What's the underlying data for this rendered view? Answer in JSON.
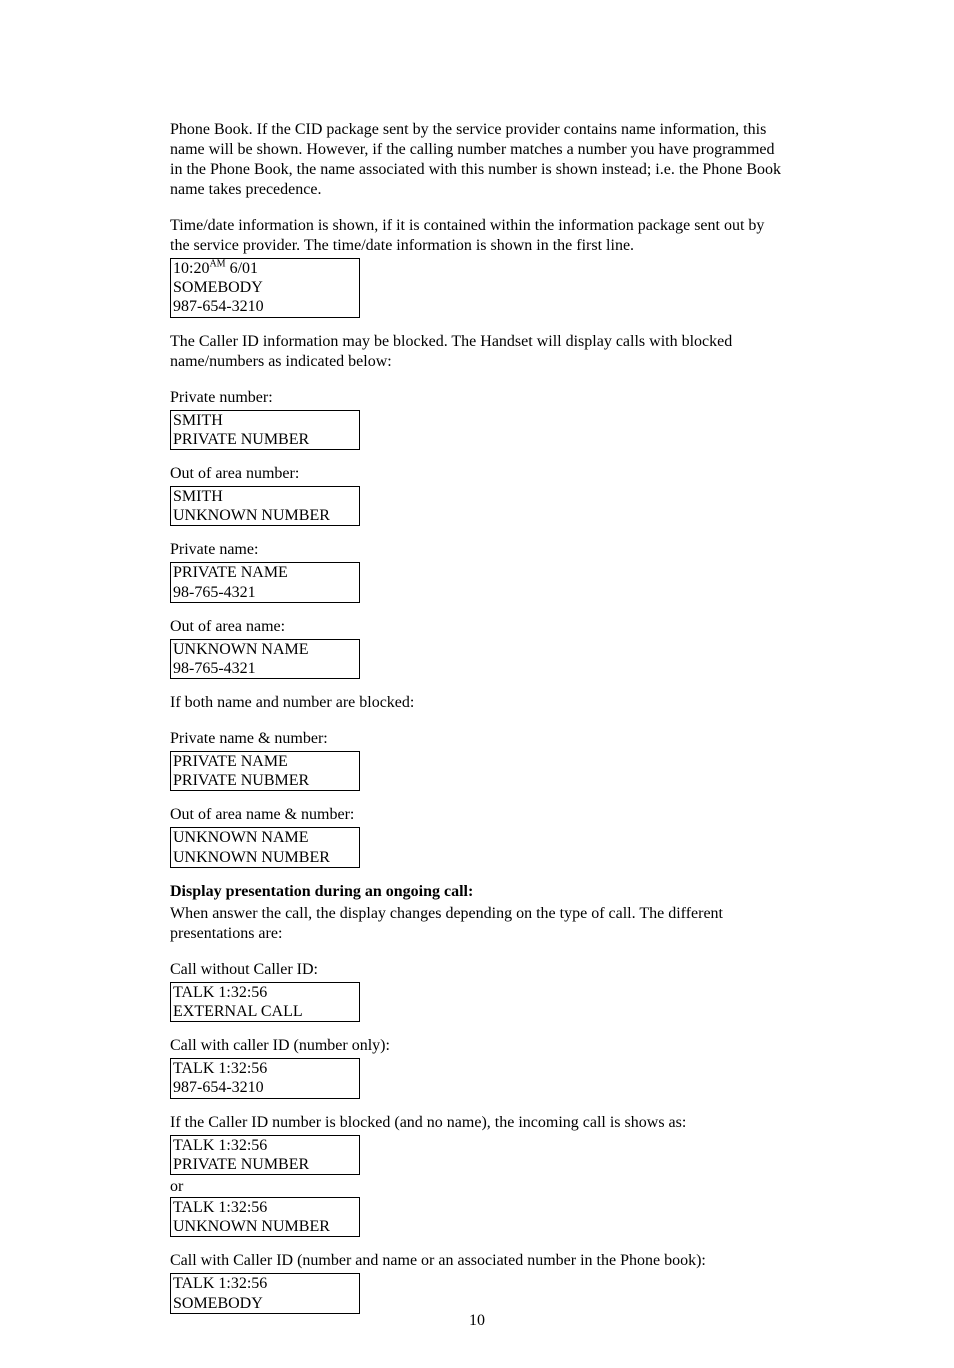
{
  "para1": "Phone Book. If the CID package sent by the service provider contains name information, this name will be shown. However, if the calling number matches a number you have programmed in the Phone Book, the name associated with this number is shown instead; i.e. the Phone Book name takes precedence.",
  "para2": "Time/date information is shown, if it is contained within the information package sent out by the service provider. The time/date information is shown in the first line.",
  "box_time": {
    "time_prefix": "10:20",
    "time_ampm": "AM",
    "time_date": " 6/01",
    "l2": "SOMEBODY",
    "l3": "987-654-3210"
  },
  "para3": "The Caller ID information may be blocked. The Handset will display calls with blocked name/numbers as indicated below:",
  "label_private_number": "Private number:",
  "box_private_number": {
    "l1": "SMITH",
    "l2": "PRIVATE NUMBER"
  },
  "label_ooa_number": "Out of area number:",
  "box_ooa_number": {
    "l1": "SMITH",
    "l2": "UNKNOWN NUMBER"
  },
  "label_private_name": "Private name:",
  "box_private_name": {
    "l1": "PRIVATE NAME",
    "l2": "98-765-4321"
  },
  "label_ooa_name": "Out of area name:",
  "box_ooa_name": {
    "l1": "UNKNOWN NAME",
    "l2": "98-765-4321"
  },
  "para4": "If both name and number are blocked:",
  "label_private_nn": "Private name & number:",
  "box_private_nn": {
    "l1": "PRIVATE NAME",
    "l2": "PRIVATE NUBMER"
  },
  "label_ooa_nn": "Out of area name & number:",
  "box_ooa_nn": {
    "l1": "UNKNOWN NAME",
    "l2": "UNKNOWN NUMBER"
  },
  "heading_display": "Display presentation during an ongoing call:",
  "para5": "When answer the call, the display changes depending on the type of call. The different presentations are:",
  "label_no_cid": "Call without Caller ID:",
  "box_no_cid": {
    "l1": "TALK 1:32:56",
    "l2": "EXTERNAL CALL"
  },
  "label_cid_num": "Call with caller ID (number only):",
  "box_cid_num": {
    "l1": "TALK 1:32:56",
    "l2": "987-654-3210"
  },
  "para6": "If the Caller ID number is blocked (and no name), the incoming call is shows as:",
  "box_blocked1": {
    "l1": "TALK 1:32:56",
    "l2": "PRIVATE NUMBER"
  },
  "or_text": "or",
  "box_blocked2": {
    "l1": "TALK 1:32:56",
    "l2": "UNKNOWN NUMBER"
  },
  "label_cid_full": "Call with Caller ID (number and name or an associated number in the Phone book):",
  "box_cid_full": {
    "l1": "TALK 1:32:56",
    "l2": "SOMEBODY"
  },
  "page_number": "10"
}
